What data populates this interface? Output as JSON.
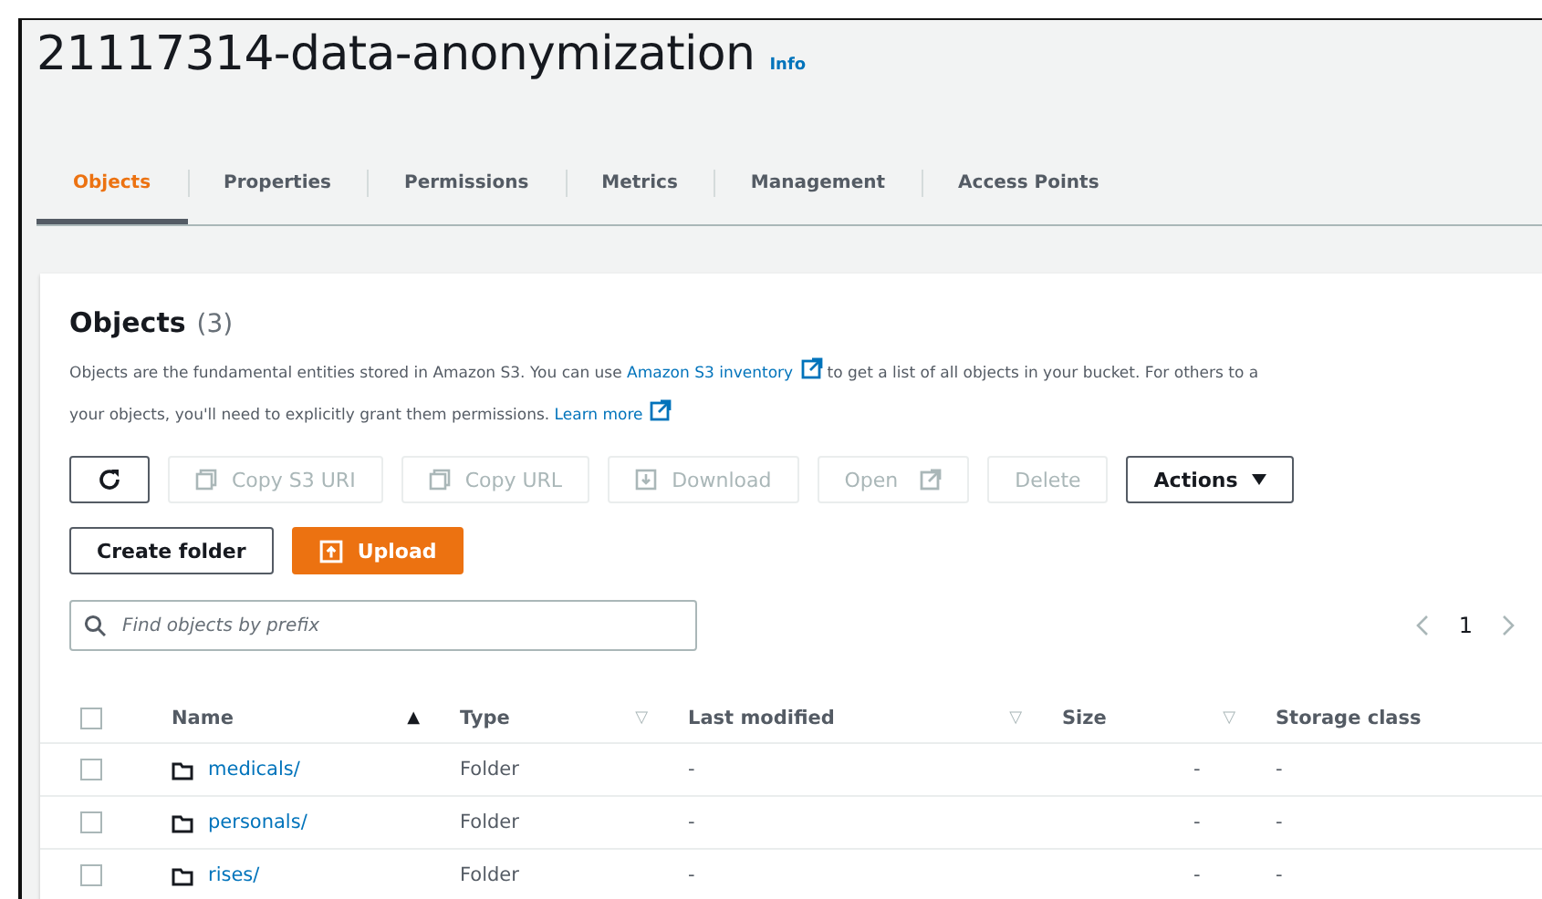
{
  "header": {
    "title": "21117314-data-anonymization",
    "info": "Info"
  },
  "tabs": [
    {
      "label": "Objects",
      "selected": true
    },
    {
      "label": "Properties",
      "selected": false
    },
    {
      "label": "Permissions",
      "selected": false
    },
    {
      "label": "Metrics",
      "selected": false
    },
    {
      "label": "Management",
      "selected": false
    },
    {
      "label": "Access Points",
      "selected": false
    }
  ],
  "objects": {
    "heading": "Objects",
    "count": "(3)",
    "description": [
      [
        {
          "text": "Objects are the fundamental entities stored in Amazon S3. You can use "
        },
        {
          "text": "Amazon S3 inventory",
          "link": true
        },
        {
          "text": " to get a list of all objects in your bucket. For others to a"
        }
      ],
      [
        {
          "text": "your objects, you'll need to explicitly grant them permissions. "
        },
        {
          "text": "Learn more",
          "link": true
        }
      ]
    ],
    "toolbar": [
      {
        "kind": "refresh",
        "disabled": false
      },
      {
        "kind": "copy",
        "label": "Copy S3 URI",
        "disabled": true
      },
      {
        "kind": "copy",
        "label": "Copy URL",
        "disabled": true
      },
      {
        "kind": "download",
        "label": "Download",
        "disabled": true
      },
      {
        "kind": "open",
        "label": "Open",
        "disabled": true
      },
      {
        "kind": "plain",
        "label": "Delete",
        "disabled": true
      },
      {
        "kind": "dropdown",
        "label": "Actions",
        "disabled": false
      }
    ],
    "actions": [
      {
        "kind": "plain",
        "label": "Create folder",
        "primary": false
      },
      {
        "kind": "upload",
        "label": "Upload",
        "primary": true
      }
    ],
    "search": {
      "placeholder": "Find objects by prefix"
    },
    "pagination": {
      "page": "1"
    },
    "all_selected": false,
    "columns": [
      {
        "label": "Name",
        "indicator": "▲"
      },
      {
        "label": "Type",
        "indicator": "▽"
      },
      {
        "label": "Last modified",
        "indicator": "▽"
      },
      {
        "label": "Size",
        "indicator": "▽"
      },
      {
        "label": "Storage class"
      }
    ],
    "rows": [
      {
        "name": "medicals/",
        "type": "Folder",
        "modified": "-",
        "size": "-",
        "storage": "-",
        "checked": false
      },
      {
        "name": "personals/",
        "type": "Folder",
        "modified": "-",
        "size": "-",
        "storage": "-",
        "checked": false
      },
      {
        "name": "rises/",
        "type": "Folder",
        "modified": "-",
        "size": "-",
        "storage": "-",
        "checked": false
      }
    ]
  }
}
